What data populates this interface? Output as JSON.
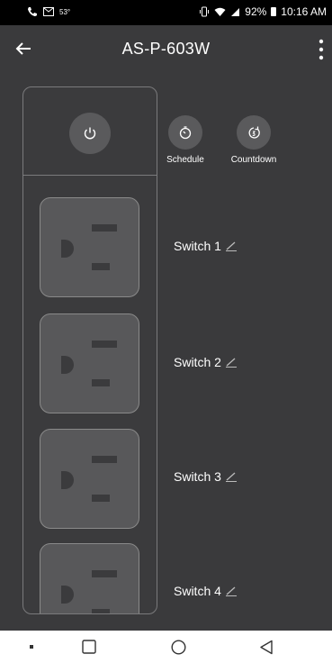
{
  "status_bar": {
    "temperature": "53°",
    "battery_percent": "92%",
    "time": "10:16 AM",
    "icons": [
      "phone-icon",
      "message-icon",
      "vibrate-icon",
      "wifi-icon",
      "signal-icon",
      "battery-icon"
    ]
  },
  "header": {
    "title": "AS-P-603W",
    "back_icon": "arrow-left-icon",
    "menu_icon": "more-vertical-icon"
  },
  "actions": {
    "schedule_label": "Schedule",
    "countdown_label": "Countdown"
  },
  "switches": [
    {
      "label": "Switch 1"
    },
    {
      "label": "Switch 2"
    },
    {
      "label": "Switch 3"
    },
    {
      "label": "Switch 4"
    }
  ],
  "colors": {
    "background": "#3a3a3c",
    "button": "#5a5a5c",
    "outlet": "#58585a",
    "status_bar": "#000000",
    "nav_bar": "#ffffff"
  },
  "nav": [
    "recent-dot-icon",
    "square-icon",
    "circle-home-icon",
    "triangle-back-icon"
  ]
}
